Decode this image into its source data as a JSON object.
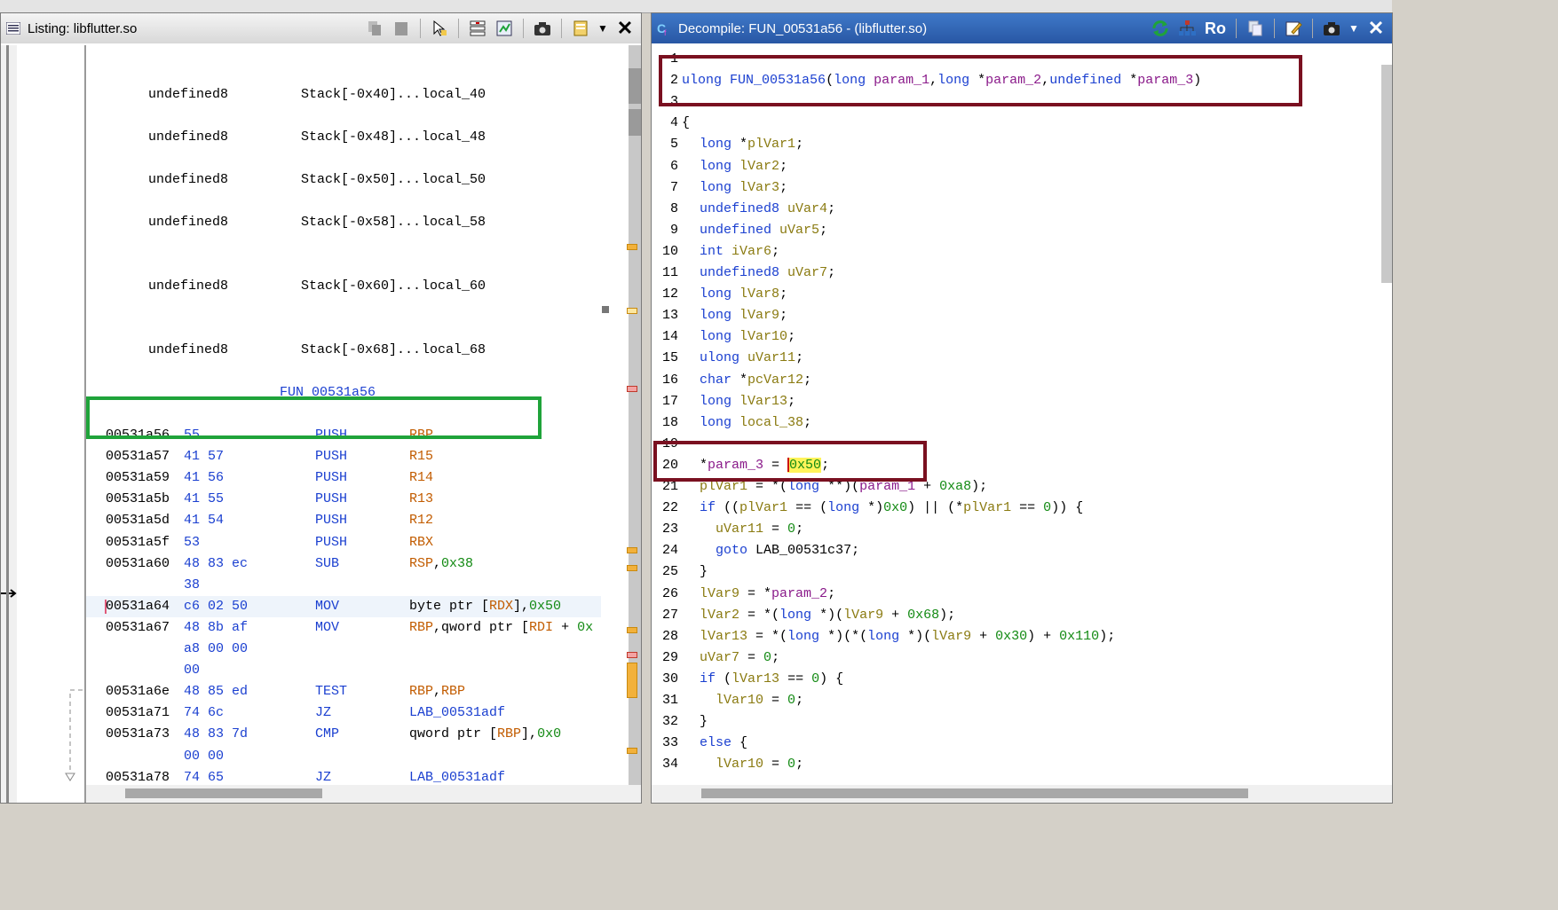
{
  "listing": {
    "title": "Listing:  libflutter.so",
    "vars": [
      {
        "type": "undefined8",
        "stack": "Stack[-0x40]...",
        "name": "local_40"
      },
      {
        "type": "undefined8",
        "stack": "Stack[-0x48]...",
        "name": "local_48"
      },
      {
        "type": "undefined8",
        "stack": "Stack[-0x50]...",
        "name": "local_50"
      },
      {
        "type": "undefined8",
        "stack": "Stack[-0x58]...",
        "name": "local_58"
      },
      {
        "type": "undefined8",
        "stack": "Stack[-0x60]...",
        "name": "local_60"
      },
      {
        "type": "undefined8",
        "stack": "Stack[-0x68]...",
        "name": "local_68"
      }
    ],
    "function_label": "FUN_00531a56",
    "instructions": [
      {
        "addr": "00531a56",
        "bytes": "55",
        "mn": "PUSH",
        "op": "RBP"
      },
      {
        "addr": "00531a57",
        "bytes": "41 57",
        "mn": "PUSH",
        "op": "R15"
      },
      {
        "addr": "00531a59",
        "bytes": "41 56",
        "mn": "PUSH",
        "op": "R14"
      },
      {
        "addr": "00531a5b",
        "bytes": "41 55",
        "mn": "PUSH",
        "op": "R13"
      },
      {
        "addr": "00531a5d",
        "bytes": "41 54",
        "mn": "PUSH",
        "op": "R12"
      },
      {
        "addr": "00531a5f",
        "bytes": "53",
        "mn": "PUSH",
        "op": "RBX"
      },
      {
        "addr": "00531a60",
        "bytes": "48 83 ec",
        "mn": "SUB",
        "op": "RSP,0x38"
      },
      {
        "addr": "",
        "bytes": "38",
        "mn": "",
        "op": ""
      },
      {
        "addr": "00531a64",
        "bytes": "c6 02 50",
        "mn": "MOV",
        "op": "byte ptr [RDX],0x50"
      },
      {
        "addr": "00531a67",
        "bytes": "48 8b af",
        "mn": "MOV",
        "op": "RBP,qword ptr [RDI + 0x"
      },
      {
        "addr": "",
        "bytes": "a8 00 00",
        "mn": "",
        "op": ""
      },
      {
        "addr": "",
        "bytes": "00",
        "mn": "",
        "op": ""
      },
      {
        "addr": "00531a6e",
        "bytes": "48 85 ed",
        "mn": "TEST",
        "op": "RBP,RBP"
      },
      {
        "addr": "00531a71",
        "bytes": "74 6c",
        "mn": "JZ",
        "op": "LAB_00531adf"
      },
      {
        "addr": "00531a73",
        "bytes": "48 83 7d",
        "mn": "CMP",
        "op": "qword ptr [RBP],0x0"
      },
      {
        "addr": "",
        "bytes": "00 00",
        "mn": "",
        "op": ""
      },
      {
        "addr": "00531a78",
        "bytes": "74 65",
        "mn": "JZ",
        "op": "LAB_00531adf"
      }
    ]
  },
  "decompile": {
    "title": "Decompile: FUN_00531a56 -  (libflutter.so)",
    "ro_label": "Ro",
    "line_numbers": [
      "1",
      "2",
      "3",
      "4",
      "5",
      "6",
      "7",
      "8",
      "9",
      "10",
      "11",
      "12",
      "13",
      "14",
      "15",
      "16",
      "17",
      "18",
      "19",
      "20",
      "21",
      "22",
      "23",
      "24",
      "25",
      "26",
      "27",
      "28",
      "29",
      "30",
      "31",
      "32",
      "33",
      "34"
    ],
    "lines": [
      "",
      "ulong FUN_00531a56(long param_1,long *param_2,undefined *param_3)",
      "",
      "{",
      "  long *plVar1;",
      "  long lVar2;",
      "  long lVar3;",
      "  undefined8 uVar4;",
      "  undefined uVar5;",
      "  int iVar6;",
      "  undefined8 uVar7;",
      "  long lVar8;",
      "  long lVar9;",
      "  long lVar10;",
      "  ulong uVar11;",
      "  char *pcVar12;",
      "  long lVar13;",
      "  long local_38;",
      "",
      "  *param_3 = 0x50;",
      "  plVar1 = *(long **)(param_1 + 0xa8);",
      "  if ((plVar1 == (long *)0x0) || (*plVar1 == 0)) {",
      "    uVar11 = 0;",
      "    goto LAB_00531c37;",
      "  }",
      "  lVar9 = *param_2;",
      "  lVar2 = *(long *)(lVar9 + 0x68);",
      "  lVar13 = *(long *)(*(long *)(lVar9 + 0x30) + 0x110);",
      "  uVar7 = 0;",
      "  if (lVar13 == 0) {",
      "    lVar10 = 0;",
      "  }",
      "  else {",
      "    lVar10 = 0;"
    ]
  },
  "colors": {
    "keyword": "#1a3fd0",
    "variable": "#8a7a10",
    "param": "#8a1a8a",
    "constant": "#138a13",
    "register": "#c25c00",
    "highlight": "#fff35a",
    "redbox": "#7a1020",
    "greenbox": "#1fa33a"
  },
  "icons": [
    "refresh-icon",
    "tree-icon",
    "copy-icon",
    "edit-icon",
    "snapshot-icon",
    "dropdown-icon",
    "close-icon"
  ]
}
